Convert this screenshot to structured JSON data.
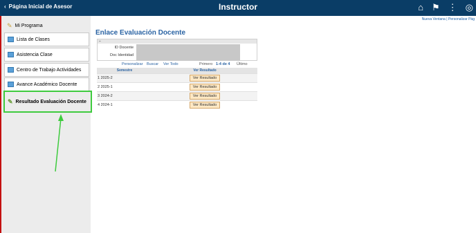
{
  "header": {
    "back_label": "Página Inicial de Asesor",
    "title": "Instructor"
  },
  "sidebar": {
    "items": [
      {
        "label": "Mi Programa",
        "icon": "program-icon"
      },
      {
        "label": "Lista de Clases",
        "icon": "folder-icon"
      },
      {
        "label": "Asistencia Clase",
        "icon": "folder-icon"
      },
      {
        "label": "Centro de Trabajo Actividades",
        "icon": "folder-icon"
      },
      {
        "label": "Avance Académico Docente",
        "icon": "folder-icon"
      },
      {
        "label": "Resultado Evaluación Docente",
        "icon": "evaluation-icon"
      }
    ]
  },
  "toplinks": "Nueva Ventana | Personalizar Pág",
  "page_title": "Enlace Evaluación Docente",
  "fields": {
    "id_label": "ID Docente",
    "doc_label": "Doc Identidad"
  },
  "toolbar": {
    "personalizar": "Personalizar",
    "buscar": "Buscar",
    "ver_todo": "Ver Todo",
    "primero": "Primero",
    "range": "1-4 de 4",
    "ultimo": "Último"
  },
  "grid": {
    "col_semestre": "Semestre",
    "col_resultado": "Ver Resultado",
    "rows": [
      {
        "n": "1",
        "semestre": "2025-2",
        "btn": "Ver Resultado"
      },
      {
        "n": "2",
        "semestre": "2025-1",
        "btn": "Ver Resultado"
      },
      {
        "n": "3",
        "semestre": "2024-2",
        "btn": "Ver Resultado"
      },
      {
        "n": "4",
        "semestre": "2024-1",
        "btn": "Ver Resultado"
      }
    ]
  }
}
